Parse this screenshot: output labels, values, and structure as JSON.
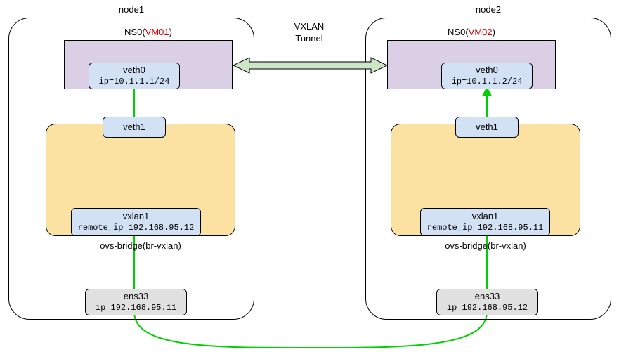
{
  "tunnel": {
    "label_line1": "VXLAN",
    "label_line2": "Tunnel"
  },
  "node1": {
    "title": "node1",
    "ns": {
      "label_prefix": "NS0(",
      "vm": "VM01",
      "label_suffix": ")",
      "veth0": {
        "name": "veth0",
        "addr": "ip=10.1.1.1/24"
      }
    },
    "ovs": {
      "label": "ovs-bridge(br-vxlan)",
      "veth1": {
        "name": "veth1"
      },
      "vxlan": {
        "name": "vxlan1",
        "addr": "remote_ip=192.168.95.12"
      }
    },
    "phys": {
      "name": "ens33",
      "addr": "ip=192.168.95.11"
    }
  },
  "node2": {
    "title": "node2",
    "ns": {
      "label_prefix": "NS0(",
      "vm": "VM02",
      "label_suffix": ")",
      "veth0": {
        "name": "veth0",
        "addr": "ip=10.1.1.2/24"
      }
    },
    "ovs": {
      "label": "ovs-bridge(br-vxlan)",
      "veth1": {
        "name": "veth1"
      },
      "vxlan": {
        "name": "vxlan1",
        "addr": "remote_ip=192.168.95.11"
      }
    },
    "phys": {
      "name": "ens33",
      "addr": "ip=192.168.95.12"
    }
  }
}
